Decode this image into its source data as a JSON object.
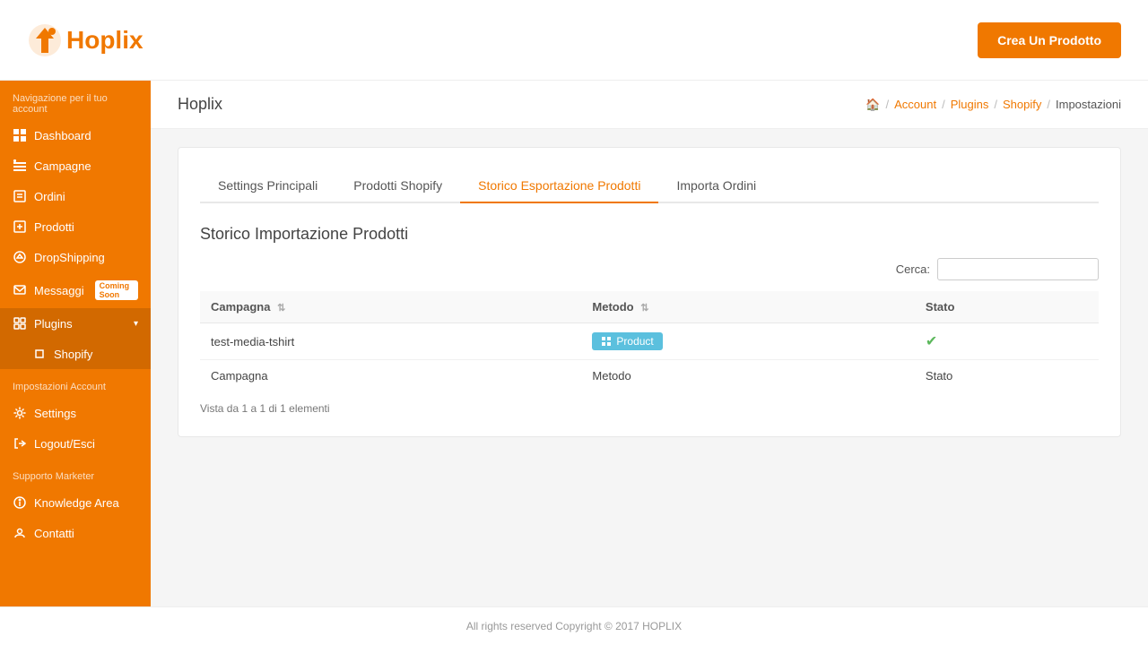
{
  "header": {
    "logo_text": "Hoplix",
    "create_button_label": "Crea Un Prodotto"
  },
  "breadcrumb": {
    "home_icon": "🏠",
    "items": [
      "Account",
      "Plugins",
      "Shopify",
      "Impostazioni"
    ]
  },
  "page_title": "Hoplix",
  "sidebar": {
    "section1_label": "Navigazione per il tuo account",
    "items": [
      {
        "label": "Dashboard",
        "icon": "dashboard"
      },
      {
        "label": "Campagne",
        "icon": "campagne"
      },
      {
        "label": "Ordini",
        "icon": "ordini"
      },
      {
        "label": "Prodotti",
        "icon": "prodotti"
      },
      {
        "label": "DropShipping",
        "icon": "dropshipping"
      },
      {
        "label": "Messaggi",
        "icon": "messaggi",
        "badge": "Coming Soon"
      },
      {
        "label": "Plugins",
        "icon": "plugins",
        "has_children": true,
        "active": true
      },
      {
        "label": "Shopify",
        "icon": "shopify",
        "sub": true,
        "active": true
      }
    ],
    "section2_label": "Impostazioni Account",
    "items2": [
      {
        "label": "Settings",
        "icon": "settings"
      },
      {
        "label": "Logout/Esci",
        "icon": "logout"
      }
    ],
    "section3_label": "Supporto Marketer",
    "items3": [
      {
        "label": "Knowledge Area",
        "icon": "knowledge"
      },
      {
        "label": "Contatti",
        "icon": "contatti"
      }
    ]
  },
  "tabs": [
    {
      "label": "Settings Principali",
      "active": false
    },
    {
      "label": "Prodotti Shopify",
      "active": false
    },
    {
      "label": "Storico Esportazione Prodotti",
      "active": true
    },
    {
      "label": "Importa Ordini",
      "active": false
    }
  ],
  "section_title": "Storico Importazione Prodotti",
  "search": {
    "label": "Cerca:",
    "placeholder": ""
  },
  "table": {
    "columns": [
      {
        "label": "Campagna"
      },
      {
        "label": "Metodo"
      },
      {
        "label": "Stato"
      }
    ],
    "rows": [
      {
        "campagna": "test-media-tshirt",
        "metodo": "Product",
        "stato": "✓"
      },
      {
        "campagna": "Campagna",
        "metodo": "Metodo",
        "stato": "Stato"
      }
    ]
  },
  "vista_text": "Vista da 1 a 1 di 1 elementi",
  "footer": {
    "text": "All rights reserved Copyright © 2017 HOPLIX"
  }
}
